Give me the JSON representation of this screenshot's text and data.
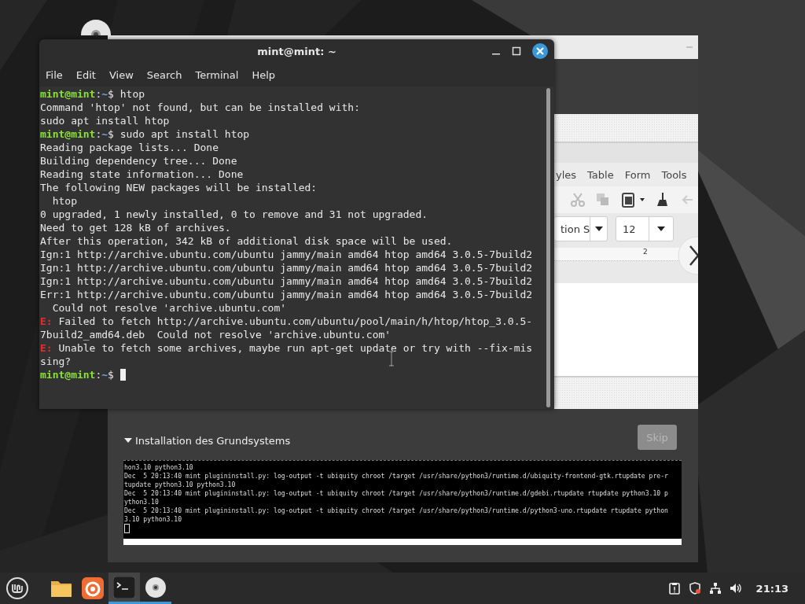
{
  "installer": {
    "slide": {
      "menu": [
        "yles",
        "Table",
        "Form",
        "Tools"
      ],
      "font_name": "tion S",
      "font_size": "12",
      "ruler_label": "2"
    },
    "section": {
      "title": "Installation des Grundsystems",
      "expanded": true
    },
    "skip_button": {
      "label": "Skip",
      "disabled": true
    },
    "log_lines": [
      "hon3.10 python3.10",
      "Dec  5 20:13:40 mint plugininstall.py: log-output -t ubiquity chroot /target /usr/share/python3/runtime.d/ubiquity-frontend-gtk.rtupdate pre-r",
      "tupdate python3.10 python3.10",
      "Dec  5 20:13:40 mint plugininstall.py: log-output -t ubiquity chroot /target /usr/share/python3/runtime.d/gdebi.rtupdate rtupdate python3.10 p",
      "ython3.10",
      "Dec  5 20:13:40 mint plugininstall.py: log-output -t ubiquity chroot /target /usr/share/python3/runtime.d/python3-uno.rtupdate rtupdate python",
      "3.10 python3.10"
    ],
    "progress": {
      "level": 1
    }
  },
  "terminal": {
    "title": "mint@mint: ~",
    "menu": [
      "File",
      "Edit",
      "View",
      "Search",
      "Terminal",
      "Help"
    ],
    "lines": [
      {
        "kind": "prompt",
        "user": "mint@mint",
        "separator": ":",
        "path": "~",
        "command": "$ htop",
        "cursor": false
      },
      {
        "kind": "output",
        "text": "Command 'htop' not found, but can be installed with:"
      },
      {
        "kind": "output",
        "text": "sudo apt install htop"
      },
      {
        "kind": "prompt",
        "user": "mint@mint",
        "separator": ":",
        "path": "~",
        "command": "$ sudo apt install htop",
        "cursor": false
      },
      {
        "kind": "output",
        "text": "Reading package lists... Done"
      },
      {
        "kind": "output",
        "text": "Building dependency tree... Done"
      },
      {
        "kind": "output",
        "text": "Reading state information... Done"
      },
      {
        "kind": "output",
        "text": "The following NEW packages will be installed:"
      },
      {
        "kind": "output",
        "text": "  htop"
      },
      {
        "kind": "output",
        "text": "0 upgraded, 1 newly installed, 0 to remove and 31 not upgraded."
      },
      {
        "kind": "output",
        "text": "Need to get 128 kB of archives."
      },
      {
        "kind": "output",
        "text": "After this operation, 342 kB of additional disk space will be used."
      },
      {
        "kind": "output",
        "text": "Ign:1 http://archive.ubuntu.com/ubuntu jammy/main amd64 htop amd64 3.0.5-7build2"
      },
      {
        "kind": "output",
        "text": "Ign:1 http://archive.ubuntu.com/ubuntu jammy/main amd64 htop amd64 3.0.5-7build2"
      },
      {
        "kind": "output",
        "text": "Ign:1 http://archive.ubuntu.com/ubuntu jammy/main amd64 htop amd64 3.0.5-7build2"
      },
      {
        "kind": "output",
        "text": "Err:1 http://archive.ubuntu.com/ubuntu jammy/main amd64 htop amd64 3.0.5-7build2"
      },
      {
        "kind": "output",
        "text": "  Could not resolve 'archive.ubuntu.com'"
      },
      {
        "kind": "error",
        "prefix": "E:",
        "text": "Failed to fetch http://archive.ubuntu.com/ubuntu/pool/main/h/htop/htop_3.0.5-"
      },
      {
        "kind": "output",
        "text": "7build2_amd64.deb  Could not resolve 'archive.ubuntu.com'"
      },
      {
        "kind": "error",
        "prefix": "E:",
        "text": "Unable to fetch some archives, maybe run apt-get update or try with --fix-mis"
      },
      {
        "kind": "output",
        "text": "sing?"
      },
      {
        "kind": "prompt",
        "user": "mint@mint",
        "separator": ":",
        "path": "~",
        "command": "$",
        "cursor": true
      }
    ]
  },
  "taskbar": {
    "apps": [
      {
        "kind": "menu",
        "running": false,
        "selected": false
      },
      {
        "kind": "files",
        "running": false,
        "selected": false
      },
      {
        "kind": "browser",
        "running": false,
        "selected": false
      },
      {
        "kind": "terminal",
        "running": true,
        "selected": true
      },
      {
        "kind": "disc",
        "running": true,
        "selected": false
      }
    ],
    "clock": "21:13"
  }
}
